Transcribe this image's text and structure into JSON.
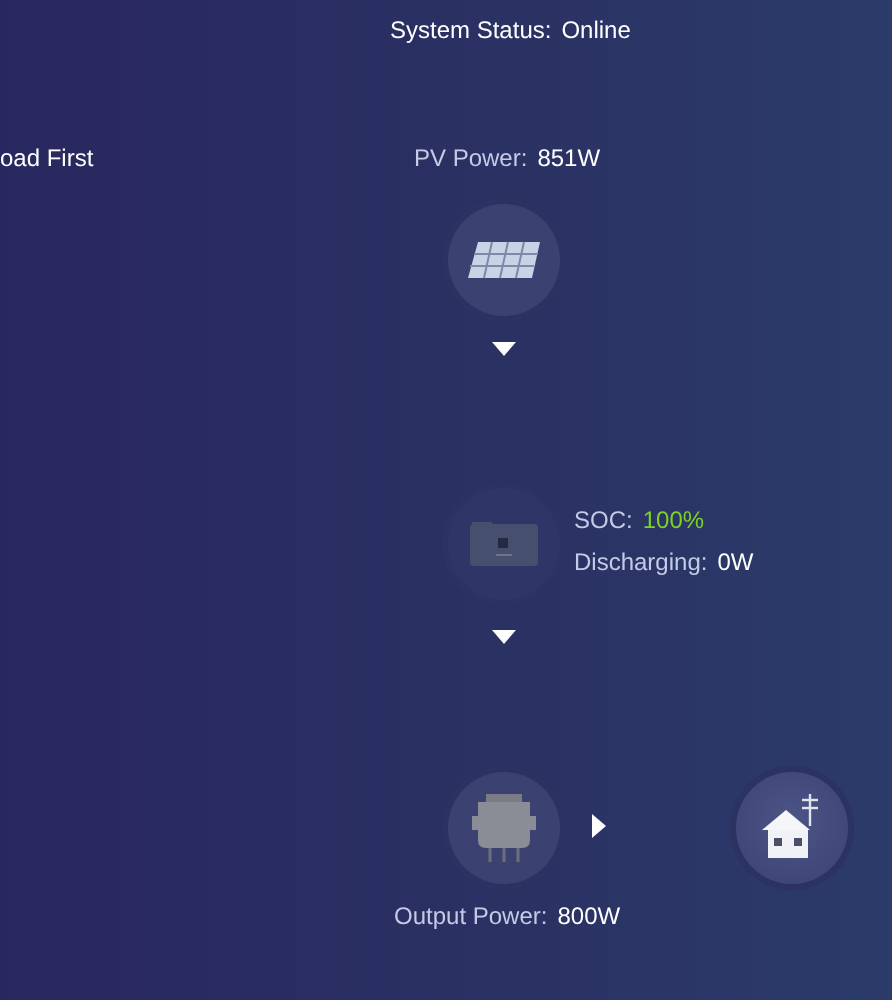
{
  "system_status": {
    "label": "System Status:",
    "value": "Online"
  },
  "mode": {
    "text": "oad First"
  },
  "pv": {
    "label": "PV Power:",
    "value": "851W"
  },
  "battery": {
    "soc_label": "SOC:",
    "soc_value": "100%",
    "flow_label": "Discharging:",
    "flow_value": "0W"
  },
  "output": {
    "label": "Output Power:",
    "value": "800W"
  }
}
